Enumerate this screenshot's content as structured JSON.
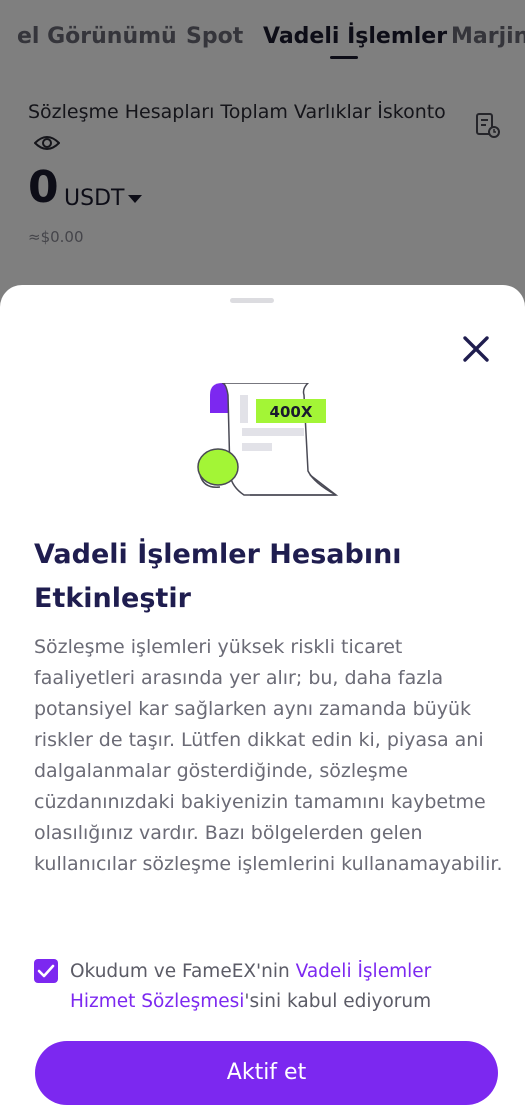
{
  "tabs": [
    {
      "label": "el Görünümü",
      "active": false
    },
    {
      "label": "Spot",
      "active": false
    },
    {
      "label": "Vadeli İşlemler",
      "active": true
    },
    {
      "label": "Marjin",
      "active": false
    }
  ],
  "account": {
    "title": "Sözleşme Hesapları Toplam Varlıklar İskonto",
    "amount": "0",
    "currency": "USDT",
    "approx": "≈$0.00"
  },
  "modal": {
    "badge": "400X",
    "title": "Vadeli İşlemler Hesabını Etkinleştir",
    "description": "Sözleşme işlemleri yüksek riskli ticaret faaliyetleri arasında yer alır; bu, daha fazla potansiyel kar sağlarken aynı zamanda büyük riskler de taşır. Lütfen dikkat edin ki, piyasa ani dalgalanmalar gösterdiğinde, sözleşme cüzdanınızdaki bakiyenizin tamamını kaybetme olasılığınız vardır. Bazı bölgelerden gelen kullanıcılar sözleşme işlemlerini kullanamayabilir.",
    "agreement": {
      "checked": true,
      "prefix": "Okudum ve FameEX'nin ",
      "link": "Vadeli İşlemler Hizmet Sözleşmesi",
      "suffix": "'sini kabul ediyorum"
    },
    "button_label": "Aktif et"
  },
  "colors": {
    "accent": "#7c28f0",
    "title": "#1f1d4f",
    "badge_green": "#a3f536"
  },
  "icons": {
    "eye": "eye-icon",
    "records": "document-clock-icon",
    "close": "close-icon",
    "check": "checkmark-icon",
    "dropdown": "caret-down-icon"
  }
}
